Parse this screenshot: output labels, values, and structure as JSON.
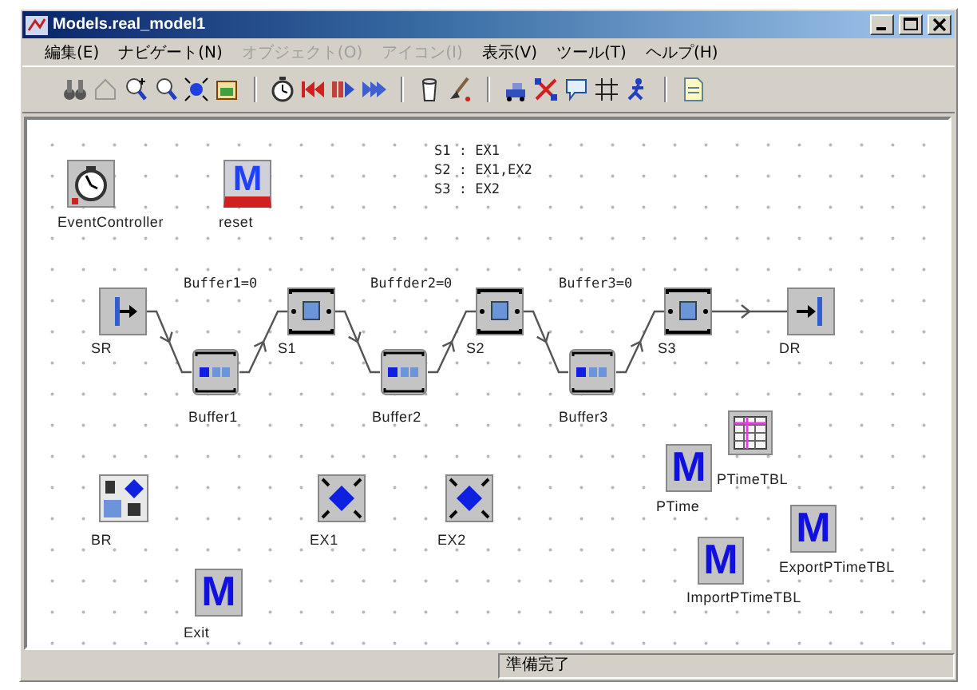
{
  "window": {
    "title": "Models.real_model1"
  },
  "menu": [
    {
      "label": "編集(E)",
      "disabled": false
    },
    {
      "label": "ナビゲート(N)",
      "disabled": false
    },
    {
      "label": "オブジェクト(O)",
      "disabled": true
    },
    {
      "label": "アイコン(I)",
      "disabled": true
    },
    {
      "label": "表示(V)",
      "disabled": false
    },
    {
      "label": "ツール(T)",
      "disabled": false
    },
    {
      "label": "ヘルプ(H)",
      "disabled": false
    }
  ],
  "toolbar": [
    [
      {
        "kind": "binoculars"
      },
      {
        "kind": "house"
      },
      {
        "kind": "zoom-in"
      },
      {
        "kind": "zoom-out"
      },
      {
        "kind": "fit"
      },
      {
        "kind": "frame"
      }
    ],
    [
      {
        "kind": "stopwatch"
      },
      {
        "kind": "rewind"
      },
      {
        "kind": "step"
      },
      {
        "kind": "fast-forward"
      }
    ],
    [
      {
        "kind": "bin"
      },
      {
        "kind": "brush"
      }
    ],
    [
      {
        "kind": "vehicle"
      },
      {
        "kind": "cross"
      },
      {
        "kind": "comment"
      },
      {
        "kind": "grid"
      },
      {
        "kind": "runner"
      }
    ],
    [
      {
        "kind": "document"
      }
    ]
  ],
  "canvas": {
    "legend": [
      "S1 : EX1",
      "S2 : EX1,EX2",
      "S3 : EX2"
    ],
    "notes": [
      "Buffer1=0",
      "Buffder2=0",
      "Buffer3=0"
    ],
    "nodes": [
      {
        "kind": "timer",
        "label": "EventController"
      },
      {
        "kind": "reset",
        "label": "reset",
        "glyph": "M"
      },
      {
        "kind": "source",
        "label": "SR"
      },
      {
        "kind": "buffer",
        "label": "Buffer1"
      },
      {
        "kind": "station",
        "label": "S1"
      },
      {
        "kind": "buffer",
        "label": "Buffer2"
      },
      {
        "kind": "station",
        "label": "S2"
      },
      {
        "kind": "buffer",
        "label": "Buffer3"
      },
      {
        "kind": "station",
        "label": "S3"
      },
      {
        "kind": "sink",
        "label": "DR"
      },
      {
        "kind": "breakdown",
        "label": "BR"
      },
      {
        "kind": "generator",
        "label": "EX1"
      },
      {
        "kind": "generator",
        "label": "EX2"
      },
      {
        "kind": "method",
        "label": "Exit",
        "glyph": "M"
      },
      {
        "kind": "table",
        "label": "PTimeTBL"
      },
      {
        "kind": "method",
        "label": "PTime",
        "glyph": "M"
      },
      {
        "kind": "method",
        "label": "ImportPTimeTBL",
        "glyph": "M"
      },
      {
        "kind": "method",
        "label": "ExportPTimeTBL",
        "glyph": "M"
      }
    ]
  },
  "status_bar": {
    "text": "準備完了"
  }
}
